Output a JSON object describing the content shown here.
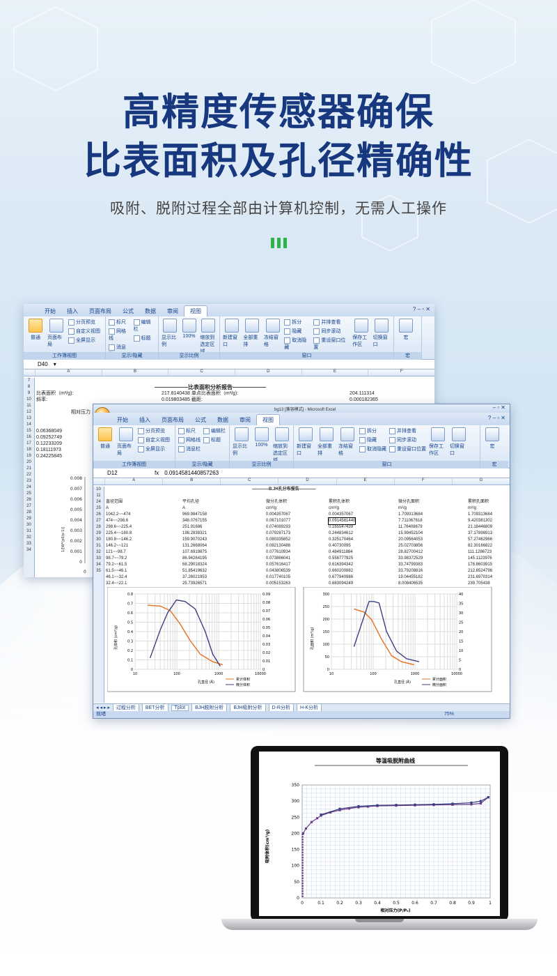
{
  "hero": {
    "title_line1": "高精度传感器确保",
    "title_line2": "比表面积及孔径精确性",
    "subtitle": "吸附、脱附过程全部由计算机控制，无需人工操作",
    "title_color": "#17387e",
    "accent_color": "#2db24a"
  },
  "back_window": {
    "ribbon_tabs": [
      "开始",
      "插入",
      "页面布局",
      "公式",
      "数据",
      "审阅",
      "视图"
    ],
    "active_tab": "视图",
    "groups": {
      "views": {
        "label": "工作簿视图",
        "btn_normal": "普通",
        "btn_layout": "页面布局",
        "items": [
          "分页预览",
          "自定义视图",
          "全屏显示"
        ]
      },
      "showhide": {
        "label": "显示/隐藏",
        "items": [
          "标尺",
          "编辑栏",
          "网格线",
          "标题",
          "消息栏"
        ]
      },
      "zoom": {
        "label": "显示比例",
        "btn_zoom": "显示比例",
        "btn_100": "100%",
        "btn_sel": "缩放到选定区域"
      },
      "window": {
        "label": "窗口",
        "btn_new": "新建窗口",
        "btn_arrange": "全部重排",
        "btn_freeze": "冻结窗格",
        "items": [
          "拆分",
          "隐藏",
          "取消隐藏",
          "并排查看",
          "同步滚动",
          "重设窗口位置"
        ],
        "btn_save": "保存工作区",
        "btn_switch": "切换窗口"
      },
      "macro": {
        "label": "宏",
        "btn": "宏"
      }
    },
    "cell_ref": "D40",
    "columns": [
      "A",
      "B",
      "C",
      "D",
      "E",
      "F"
    ],
    "rows": [
      {
        "n": "7",
        "cells": []
      },
      {
        "n": "8",
        "cells": [
          "——————比表面积分析报告——————"
        ]
      },
      {
        "n": "9",
        "cells": [
          "比表面积（m²/g):",
          "217.8140438 单点比表面积（m²/g):",
          "204.111314"
        ]
      },
      {
        "n": "10",
        "cells": [
          "斜率:",
          "0.019803485 截距:",
          "0.000182365"
        ]
      },
      {
        "n": "11",
        "cells": []
      },
      {
        "n": "12",
        "cells": [
          "相对压力"
        ]
      },
      {
        "n": "13",
        "cells": []
      },
      {
        "n": "14",
        "cells": []
      },
      {
        "n": "15",
        "cells": [
          "0.06368049"
        ]
      },
      {
        "n": "16",
        "cells": [
          "0.09252749"
        ]
      },
      {
        "n": "17",
        "cells": [
          "0.12233209"
        ]
      },
      {
        "n": "18",
        "cells": [
          "0.18111973"
        ]
      },
      {
        "n": "19",
        "cells": [
          "0.24225845"
        ]
      },
      {
        "n": "20",
        "cells": []
      }
    ],
    "left_chart_ticks": [
      "0.008",
      "0.007",
      "0.006",
      "0.005",
      "0.004",
      "0.003",
      "0.002",
      "0.001",
      "0"
    ],
    "left_chart_ylabel": "1/[W*(p0/p-1)]",
    "left_chart_xtick": "0",
    "extra_rownums": [
      "21",
      "22",
      "23",
      "24",
      "25",
      "26",
      "27",
      "28",
      "29",
      "30",
      "31",
      "32",
      "33",
      "34"
    ]
  },
  "front_window": {
    "title": "bg13 [兼容模式] - Microsoft Excel",
    "ribbon_tabs": [
      "开始",
      "插入",
      "页面布局",
      "公式",
      "数据",
      "审阅",
      "视图"
    ],
    "active_tab": "视图",
    "cell_ref": "D12",
    "formula": "0.0914581440857263",
    "columns": [
      "A",
      "B",
      "C",
      "D",
      "E",
      "F",
      "G"
    ],
    "report_title": "————B.JH孔分布报告————",
    "headers": [
      "直径范围",
      "平均孔径",
      "微分孔体积",
      "累积孔体积",
      "微分孔面积",
      "累积孔面积"
    ],
    "units": [
      "A",
      "A",
      "cm³/g",
      "cm³/g",
      "m²/g",
      "m²/g"
    ],
    "rownums": [
      "10",
      "11",
      "24",
      "25",
      "26",
      "27",
      "28",
      "29",
      "30",
      "31",
      "32",
      "33",
      "34",
      "35"
    ],
    "table": [
      [
        "1042.2~~474",
        "969.9847158",
        "0.004357067",
        "0.004357067",
        "1.709313684",
        "1.709313684"
      ],
      [
        "474~~298.6",
        "348.0767155",
        "0.067101077",
        "0.0914581440",
        "7.711067618",
        "9.420381302"
      ],
      [
        "298.6~~225.4",
        "251.91686",
        "0.074089293",
        "0.165547439",
        "11.76408679",
        "21.18446809"
      ],
      [
        "225.4~~180.8",
        "198.2838321",
        "0.079287173",
        "0.244834612",
        "15.99452104",
        "37.17898913"
      ],
      [
        "180.8~~146.2",
        "159.9070243",
        "0.080335852",
        "0.325170464",
        "20.09564053",
        "57.27462966"
      ],
      [
        "146.2~~121",
        "131.2668064",
        "0.082130486",
        "0.40730095",
        "25.02703856",
        "82.30166822"
      ],
      [
        "121~~98.7",
        "107.6919875",
        "0.077610934",
        "0.484911884",
        "28.82700412",
        "111.1286723"
      ],
      [
        "98.7~~79.2",
        "86.94284195",
        "0.073866041",
        "0.558777925",
        "33.98372529",
        "145.1123976"
      ],
      [
        "79.2~~61.5",
        "68.29018324",
        "0.057616417",
        "0.616394342",
        "33.74799383",
        "178.8603915"
      ],
      [
        "61.5~~46.1",
        "51.85419632",
        "0.043806539",
        "0.660200882",
        "33.79208816",
        "212.6524796"
      ],
      [
        "46.1~~32.4",
        "37.26021953",
        "0.017740105",
        "0.677940986",
        "19.04455182",
        "231.6970314"
      ],
      [
        "32.4~~22.1",
        "25.73926571",
        "0.005153263",
        "0.683094249",
        "8.008406535",
        "239.705438"
      ]
    ],
    "chart1": {
      "ylabel": "孔体积 (cm³/g)",
      "xlabel": "孔直径 (Å)",
      "legend": [
        "累计体积",
        "微分体积"
      ],
      "yticks_left": [
        "0.8",
        "0.7",
        "0.6",
        "0.5",
        "0.4",
        "0.3",
        "0.2",
        "0.1",
        "0"
      ],
      "yticks_right": [
        "0.09",
        "0.08",
        "0.07",
        "0.06",
        "0.05",
        "0.04",
        "0.03",
        "0.02",
        "0.01",
        "0"
      ],
      "xticks": [
        "10",
        "100",
        "1000",
        "10000"
      ]
    },
    "chart2": {
      "ylabel": "孔面积 (m²/g)",
      "xlabel": "孔直径 (Å)",
      "legend": [
        "累计面积",
        "微分面积"
      ],
      "yticks_left": [
        "300",
        "250",
        "200",
        "150",
        "100",
        "50",
        "0"
      ],
      "yticks_right": [
        "40",
        "35",
        "30",
        "25",
        "20",
        "15",
        "10",
        "5",
        "0"
      ],
      "xticks": [
        "10",
        "100",
        "1000",
        "10000"
      ]
    },
    "sheet_tabs": [
      "过程分析",
      "BET分析",
      "Tplot",
      "BJH脱附分析",
      "BJH吸附分析",
      "D-R分析",
      "H-K分析"
    ],
    "status": "就绪",
    "zoom": "75%",
    "colors": {
      "cumulative": "#e8701e",
      "differential": "#3a3f82"
    }
  },
  "laptop": {
    "chart_title": "等温吸脱附曲线",
    "ylabel": "吸附体积(cm³/g)",
    "xlabel": "相对压力(P/P₀)",
    "yticks": [
      "350",
      "300",
      "250",
      "200",
      "150",
      "100",
      "50",
      "0"
    ],
    "xticks": [
      "0",
      "0.1",
      "0.2",
      "0.3",
      "0.4",
      "0.5",
      "0.6",
      "0.7",
      "0.8",
      "0.9",
      "1"
    ]
  },
  "chart_data": {
    "type": "line",
    "title": "等温吸脱附曲线",
    "xlabel": "相对压力(P/P₀)",
    "ylabel": "吸附体积(cm³/g)",
    "xlim": [
      0,
      1
    ],
    "ylim": [
      0,
      350
    ],
    "series": [
      {
        "values": [
          [
            0.005,
            200
          ],
          [
            0.02,
            215
          ],
          [
            0.05,
            235
          ],
          [
            0.08,
            247
          ],
          [
            0.1,
            255
          ],
          [
            0.15,
            265
          ],
          [
            0.2,
            272
          ],
          [
            0.25,
            277
          ],
          [
            0.3,
            281
          ],
          [
            0.35,
            283
          ],
          [
            0.4,
            285
          ],
          [
            0.5,
            286
          ],
          [
            0.6,
            287
          ],
          [
            0.7,
            288
          ],
          [
            0.8,
            289
          ],
          [
            0.9,
            290
          ],
          [
            0.95,
            293
          ],
          [
            0.99,
            312
          ]
        ]
      },
      {
        "values": [
          [
            0.99,
            312
          ],
          [
            0.95,
            300
          ],
          [
            0.9,
            295
          ],
          [
            0.8,
            292
          ],
          [
            0.7,
            290
          ],
          [
            0.6,
            289
          ],
          [
            0.5,
            288
          ],
          [
            0.4,
            287
          ],
          [
            0.3,
            284
          ],
          [
            0.2,
            276
          ],
          [
            0.1,
            258
          ]
        ]
      }
    ]
  }
}
